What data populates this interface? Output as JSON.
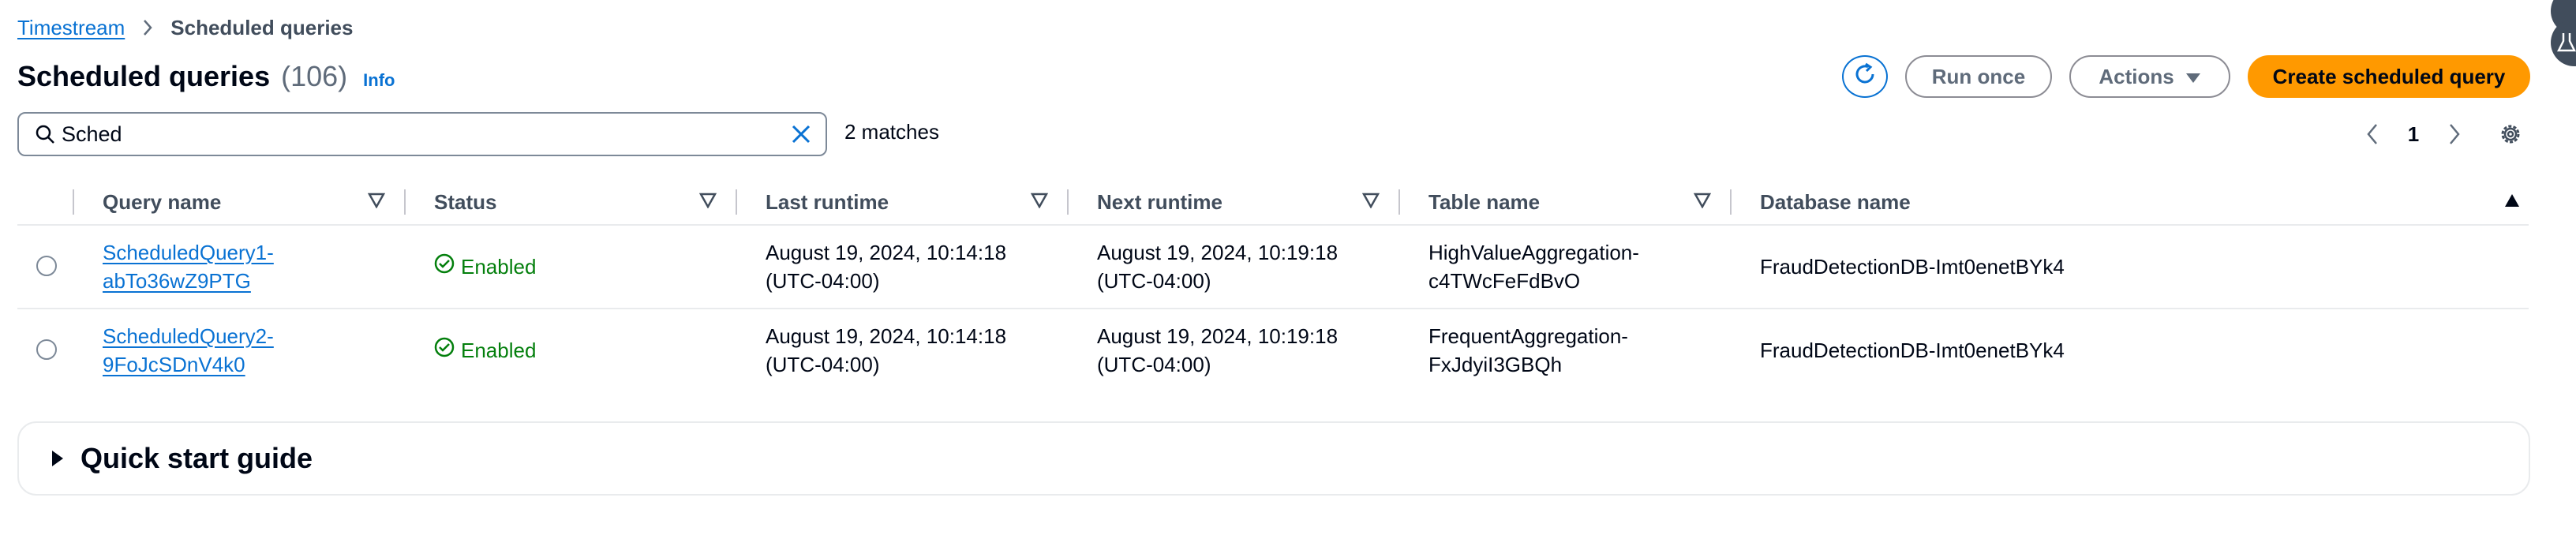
{
  "breadcrumb": {
    "root": "Timestream",
    "current": "Scheduled queries"
  },
  "header": {
    "title": "Scheduled queries",
    "count": "(106)",
    "info": "Info"
  },
  "toolbar": {
    "run_once": "Run once",
    "actions": "Actions",
    "create": "Create scheduled query"
  },
  "search": {
    "value": "Sched",
    "matches": "2 matches"
  },
  "pagination": {
    "current_page": "1"
  },
  "table": {
    "columns": [
      "Query name",
      "Status",
      "Last runtime",
      "Next runtime",
      "Table name",
      "Database name"
    ],
    "rows": [
      {
        "query_line1": "ScheduledQuery1-",
        "query_line2": "abTo36wZ9PTG",
        "status": "Enabled",
        "last_line1": "August 19, 2024, 10:14:18",
        "last_line2": "(UTC-04:00)",
        "next_line1": "August 19, 2024, 10:19:18",
        "next_line2": "(UTC-04:00)",
        "table_line1": "HighValueAggregation-",
        "table_line2": "c4TWcFeFdBvO",
        "database": "FraudDetectionDB-Imt0enetBYk4"
      },
      {
        "query_line1": "ScheduledQuery2-",
        "query_line2": "9FoJcSDnV4k0",
        "status": "Enabled",
        "last_line1": "August 19, 2024, 10:14:18",
        "last_line2": "(UTC-04:00)",
        "next_line1": "August 19, 2024, 10:19:18",
        "next_line2": "(UTC-04:00)",
        "table_line1": "FrequentAggregation-",
        "table_line2": "FxJdyiI3GBQh",
        "database": "FraudDetectionDB-Imt0enetBYk4"
      }
    ]
  },
  "quick_start": {
    "title": "Quick start guide"
  },
  "icons": {
    "refresh": "refresh-icon",
    "caret": "caret-down-icon",
    "search": "search-icon",
    "clear": "close-icon",
    "prev": "chevron-left-icon",
    "next": "chevron-right-icon",
    "settings": "gear-icon",
    "filter": "filter-triangle-icon",
    "sort": "sort-ascending-icon",
    "enabled": "check-circle-icon",
    "expand": "caret-right-icon"
  },
  "colors": {
    "link": "#0972d3",
    "primary": "#ff9900",
    "success": "#037f0c",
    "border": "#7d8998"
  }
}
